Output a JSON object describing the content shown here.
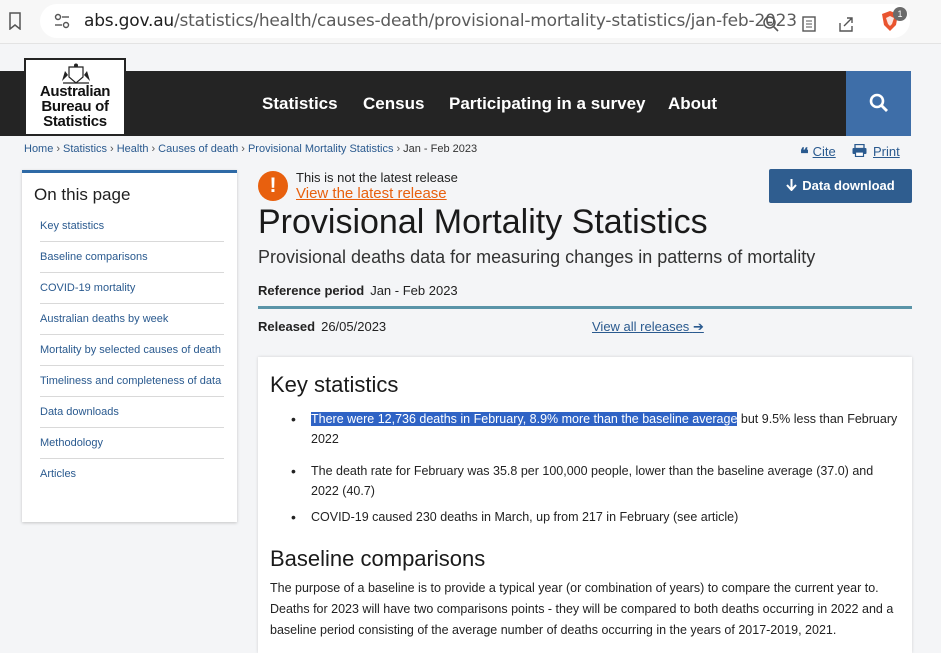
{
  "browser": {
    "url_domain": "abs.gov.au",
    "url_path": "/statistics/health/causes-death/provisional-mortality-statistics/jan-feb-2023",
    "brave_badge": "1"
  },
  "header": {
    "logo_lines": [
      "Australian",
      "Bureau of",
      "Statistics"
    ],
    "nav": [
      "Statistics",
      "Census",
      "Participating in a survey",
      "About"
    ]
  },
  "breadcrumb": [
    "Home",
    "Statistics",
    "Health",
    "Causes of death",
    "Provisional Mortality Statistics",
    "Jan - Feb 2023"
  ],
  "actions": {
    "cite": "Cite",
    "print": "Print",
    "download": "Data download"
  },
  "sidebar": {
    "title": "On this page",
    "items": [
      "Key statistics",
      "Baseline comparisons",
      "COVID-19 mortality",
      "Australian deaths by week",
      "Mortality by selected causes of death",
      "Timeliness and completeness of data",
      "Data downloads",
      "Methodology",
      "Articles"
    ]
  },
  "alert": {
    "text": "This is not the latest release",
    "link": "View the latest release"
  },
  "main": {
    "title": "Provisional Mortality Statistics",
    "subtitle": "Provisional deaths data for measuring changes in patterns of mortality",
    "ref_label": "Reference period",
    "ref_value": "Jan - Feb 2023",
    "released_label": "Released",
    "released_value": "26/05/2023",
    "view_all": "View all releases"
  },
  "key_stats": {
    "heading": "Key statistics",
    "bullet1_highlight": "There were 12,736 deaths in February, 8.9% more than the baseline average",
    "bullet1_rest": " but 9.5% less than February 2022",
    "bullet2": "The death rate for February was 35.8 per 100,000 people, lower than the baseline average (37.0) and 2022 (40.7)",
    "bullet3": "COVID-19 caused 230 deaths in March, up from 217 in February (see article)"
  },
  "baseline": {
    "heading": "Baseline comparisons",
    "text": "The purpose of a baseline is to provide a typical year (or combination of years) to compare the current year to. Deaths for 2023 will have two comparisons points - they will be compared to both deaths occurring in 2022 and a baseline period consisting of the average number of deaths occurring in the years of 2017-2019, 2021."
  }
}
